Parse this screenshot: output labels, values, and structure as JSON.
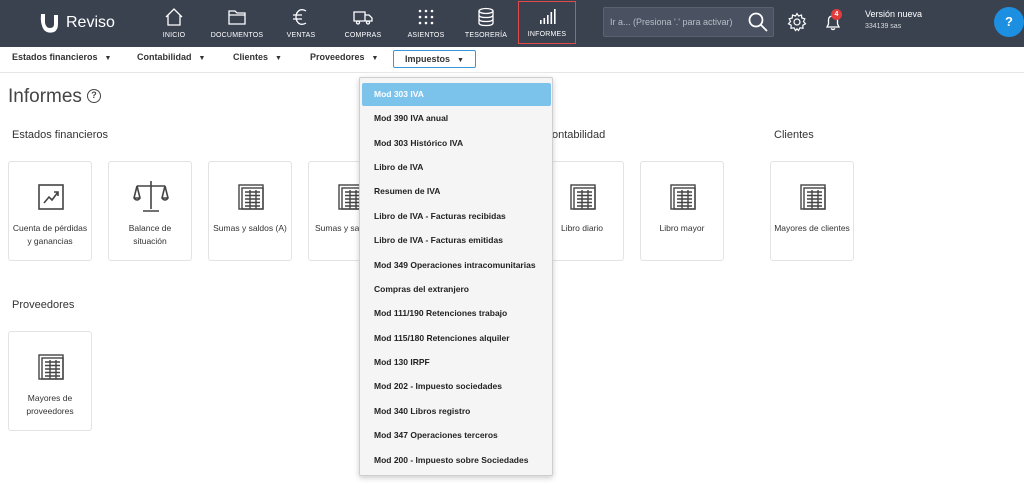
{
  "brand": {
    "name": "Reviso"
  },
  "nav": [
    {
      "label": "INICIO",
      "icon": "home-icon"
    },
    {
      "label": "DOCUMENTOS",
      "icon": "folder-icon"
    },
    {
      "label": "VENTAS",
      "icon": "euro-icon"
    },
    {
      "label": "COMPRAS",
      "icon": "truck-icon"
    },
    {
      "label": "ASIENTOS",
      "icon": "grid-dots-icon"
    },
    {
      "label": "TESORERÍA",
      "icon": "coins-icon"
    },
    {
      "label": "INFORMES",
      "icon": "bar-chart-icon"
    }
  ],
  "search": {
    "placeholder": "Ir a... (Presiona '.' para activar)"
  },
  "notifications": {
    "count": "4"
  },
  "version": {
    "title": "Versión nueva",
    "subtitle": "334139 sas"
  },
  "help": {
    "label": "?"
  },
  "subnav": [
    {
      "label": "Estados financieros"
    },
    {
      "label": "Contabilidad"
    },
    {
      "label": "Clientes"
    },
    {
      "label": "Proveedores"
    },
    {
      "label": "Impuestos"
    }
  ],
  "page": {
    "title": "Informes",
    "help": "?"
  },
  "sections": {
    "estados": {
      "title": "Estados financieros",
      "cards": [
        "Cuenta de pérdidas y ganancias",
        "Balance de situación",
        "Sumas y saldos (A)",
        "Sumas y sa"
      ]
    },
    "contabilidad": {
      "title": "ontabilidad",
      "cards": [
        "Libro diario",
        "Libro mayor"
      ]
    },
    "clientes": {
      "title": "Clientes",
      "cards": [
        "Mayores de clientes"
      ]
    },
    "proveedores": {
      "title": "Proveedores",
      "cards": [
        "Mayores de proveedores"
      ]
    }
  },
  "dropdown": {
    "items": [
      "Mod 303 IVA",
      "Mod 390 IVA anual",
      "Mod 303 Histórico IVA",
      "Libro de IVA",
      "Resumen de IVA",
      "Libro de IVA - Facturas recibidas",
      "Libro de IVA - Facturas emitidas",
      "Mod 349 Operaciones intracomunitarias",
      "Compras del extranjero",
      "Mod 111/190 Retenciones trabajo",
      "Mod 115/180 Retenciones alquiler",
      "Mod 130 IRPF",
      "Mod 202 - Impuesto sociedades",
      "Mod 340 Libros registro",
      "Mod 347 Operaciones terceros",
      "Mod 200 - Impuesto sobre Sociedades"
    ]
  },
  "colors": {
    "topbar": "#3a4250",
    "accent": "#1d8fe1",
    "highlight": "#7cc3ec",
    "active_outline": "#e14a4a"
  }
}
